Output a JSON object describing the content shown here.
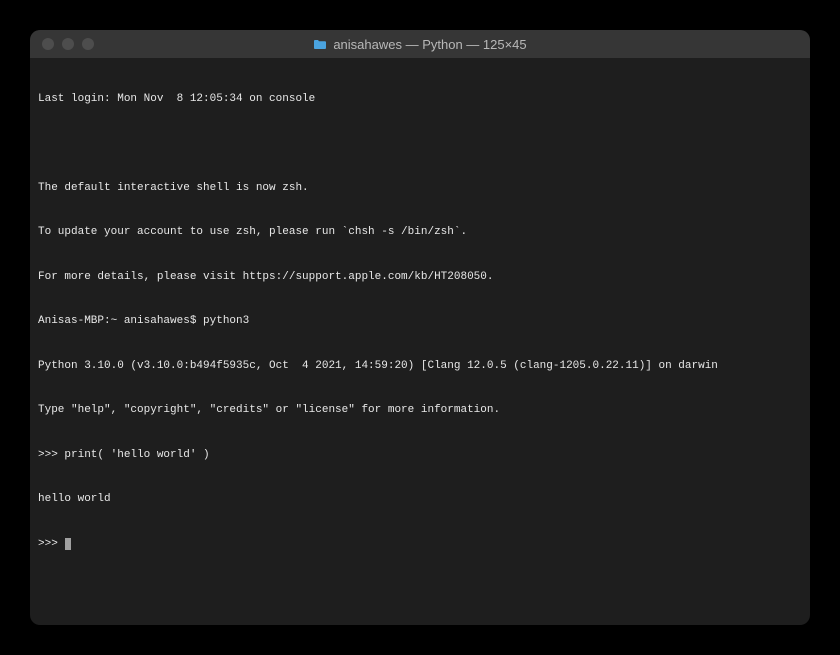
{
  "titlebar": {
    "title": "anisahawes — Python — 125×45",
    "folder_icon_color": "#4aa3df"
  },
  "terminal": {
    "lines": [
      "Last login: Mon Nov  8 12:05:34 on console",
      "",
      "The default interactive shell is now zsh.",
      "To update your account to use zsh, please run `chsh -s /bin/zsh`.",
      "For more details, please visit https://support.apple.com/kb/HT208050.",
      "Anisas-MBP:~ anisahawes$ python3",
      "Python 3.10.0 (v3.10.0:b494f5935c, Oct  4 2021, 14:59:20) [Clang 12.0.5 (clang-1205.0.22.11)] on darwin",
      "Type \"help\", \"copyright\", \"credits\" or \"license\" for more information.",
      ">>> print( 'hello world' )",
      "hello world"
    ],
    "prompt": ">>> "
  }
}
